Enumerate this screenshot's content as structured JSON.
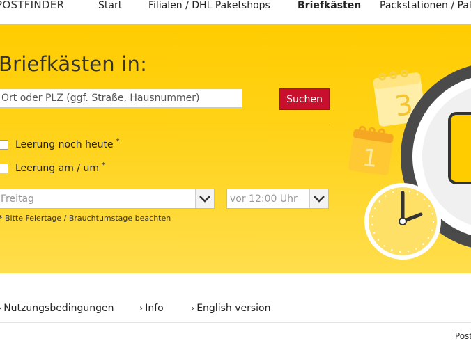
{
  "nav": {
    "brand": "POSTFINDER",
    "items": [
      "Start",
      "Filialen / DHL Paketshops",
      "Briefkästen",
      "Packstationen / Pal"
    ],
    "active_index": 2
  },
  "hero": {
    "title": "Briefkästen in:",
    "search_placeholder": "Ort oder PLZ (ggf. Straße, Hausnummer)",
    "search_button": "Suchen",
    "check_today": "Leerung noch heute",
    "check_at": "Leerung am / um",
    "asterisk": "*",
    "day_select": "Freitag",
    "time_select": "vor 12:00 Uhr",
    "note": "* Bitte Feiertage / Brauchtumstage beachten",
    "calendar_numbers": [
      "3",
      "1"
    ]
  },
  "footer": {
    "links": [
      "Nutzungsbedingungen",
      "Info",
      "English version"
    ],
    "cut_text": "Post"
  },
  "colors": {
    "yellow": "#ffcc00",
    "red": "#c8102e",
    "clock_gray": "#4a4a4a"
  }
}
